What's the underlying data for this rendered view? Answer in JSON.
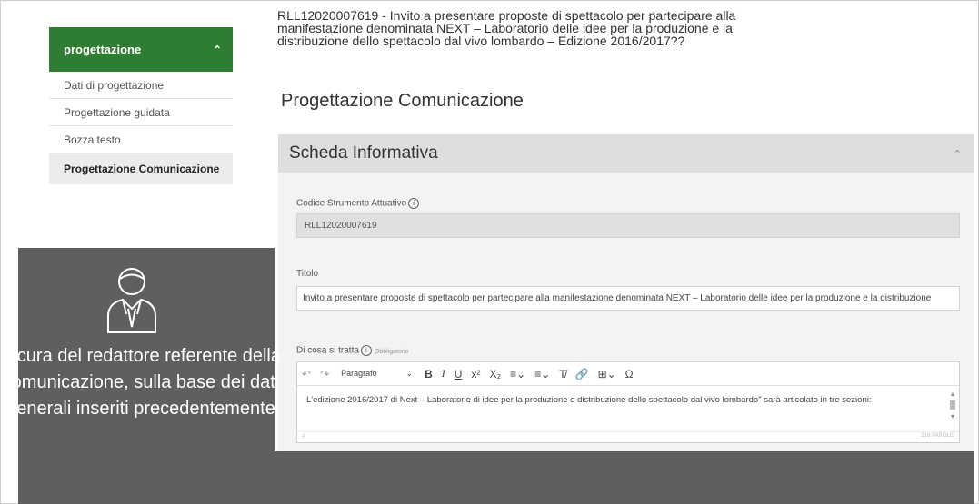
{
  "sidebar": {
    "header": "progettazione",
    "items": [
      {
        "label": "Dati di progettazione"
      },
      {
        "label": "Progettazione guidata"
      },
      {
        "label": "Bozza testo"
      },
      {
        "label": "Progettazione Comunicazione"
      }
    ]
  },
  "overlay": {
    "icon": "user-icon",
    "text": "A cura del redattore referente della comunicazione, sulla base dei dati generali inseriti precedentemente"
  },
  "header": {
    "doc_title": "RLL12020007619 - Invito a presentare proposte di spettacolo per partecipare alla manifestazione denominata NEXT – Laboratorio delle idee per la produzione e la distribuzione dello spettacolo dal vivo lombardo – Edizione 2016/2017??",
    "page_title": "Progettazione Comunicazione"
  },
  "panel": {
    "title": "Scheda Informativa",
    "codice": {
      "label": "Codice Strumento Attuativo",
      "value": "RLL12020007619"
    },
    "titolo": {
      "label": "Titolo",
      "value": "Invito a presentare proposte di spettacolo per partecipare alla manifestazione denominata  NEXT – Laboratorio delle idee per la produzione e la distribuzione"
    },
    "descrizione": {
      "label": "Di cosa si tratta",
      "hint": "Obbligatorio",
      "toolbar": {
        "format": "Paragrafo",
        "bold": "B",
        "italic": "I",
        "underline": "U",
        "superscript": "x²",
        "subscript": "X₂",
        "special_char": "Ω"
      },
      "content": "L'edizione 2016/2017 di  Next – Laboratorio di idee per la produzione e distribuzione dello spettacolo dal vivo lombardo\" sarà articolato in tre sezioni:",
      "status_left": "p",
      "word_count": "219 PAROLE"
    }
  }
}
